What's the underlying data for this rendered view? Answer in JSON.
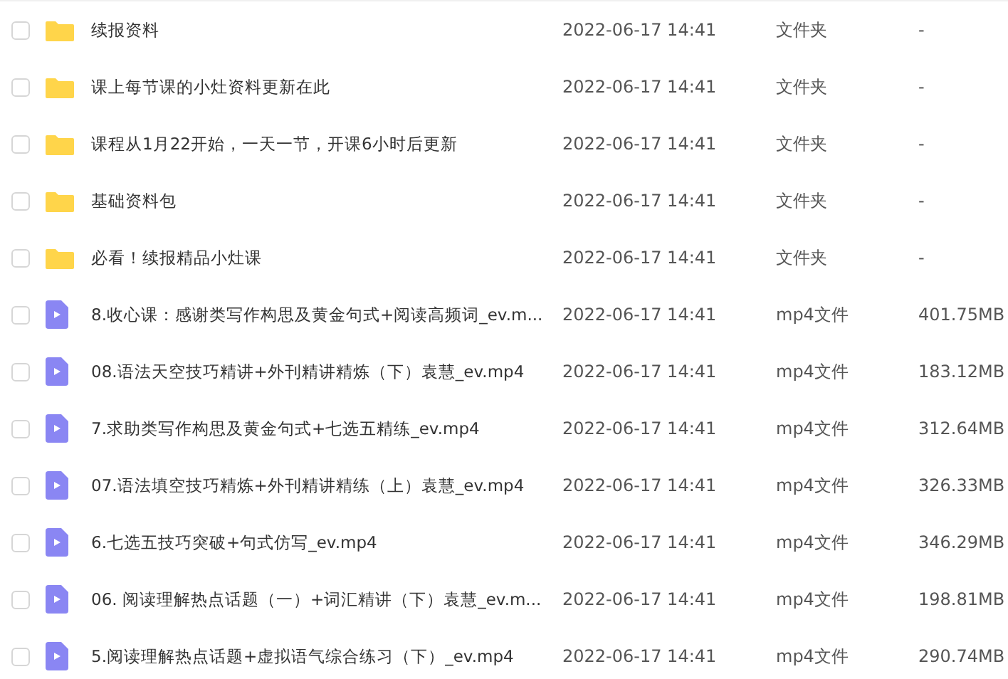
{
  "files": [
    {
      "kind": "folder",
      "checked": false,
      "name": "续报资料",
      "modified": "2022-06-17 14:41",
      "type": "文件夹",
      "size": "-"
    },
    {
      "kind": "folder",
      "checked": false,
      "name": "课上每节课的小灶资料更新在此",
      "modified": "2022-06-17 14:41",
      "type": "文件夹",
      "size": "-"
    },
    {
      "kind": "folder",
      "checked": false,
      "name": "课程从1月22开始，一天一节，开课6小时后更新",
      "modified": "2022-06-17 14:41",
      "type": "文件夹",
      "size": "-"
    },
    {
      "kind": "folder",
      "checked": false,
      "name": "基础资料包",
      "modified": "2022-06-17 14:41",
      "type": "文件夹",
      "size": "-"
    },
    {
      "kind": "folder",
      "checked": false,
      "name": "必看！续报精品小灶课",
      "modified": "2022-06-17 14:41",
      "type": "文件夹",
      "size": "-"
    },
    {
      "kind": "video",
      "checked": false,
      "name": "8.收心课：感谢类写作构思及黄金句式+阅读高频词_ev.m...",
      "modified": "2022-06-17 14:41",
      "type": "mp4文件",
      "size": "401.75MB"
    },
    {
      "kind": "video",
      "checked": false,
      "name": "08.语法天空技巧精讲+外刊精讲精炼（下）袁慧_ev.mp4",
      "modified": "2022-06-17 14:41",
      "type": "mp4文件",
      "size": "183.12MB"
    },
    {
      "kind": "video",
      "checked": false,
      "name": "7.求助类写作构思及黄金句式+七选五精练_ev.mp4",
      "modified": "2022-06-17 14:41",
      "type": "mp4文件",
      "size": "312.64MB"
    },
    {
      "kind": "video",
      "checked": false,
      "name": "07.语法填空技巧精炼+外刊精讲精练（上）袁慧_ev.mp4",
      "modified": "2022-06-17 14:41",
      "type": "mp4文件",
      "size": "326.33MB"
    },
    {
      "kind": "video",
      "checked": false,
      "name": "6.七选五技巧突破+句式仿写_ev.mp4",
      "modified": "2022-06-17 14:41",
      "type": "mp4文件",
      "size": "346.29MB"
    },
    {
      "kind": "video",
      "checked": false,
      "name": "06. 阅读理解热点话题（一）+词汇精讲（下）袁慧_ev.m...",
      "modified": "2022-06-17 14:41",
      "type": "mp4文件",
      "size": "198.81MB"
    },
    {
      "kind": "video",
      "checked": false,
      "name": "5.阅读理解热点话题+虚拟语气综合练习（下）_ev.mp4",
      "modified": "2022-06-17 14:41",
      "type": "mp4文件",
      "size": "290.74MB"
    }
  ]
}
